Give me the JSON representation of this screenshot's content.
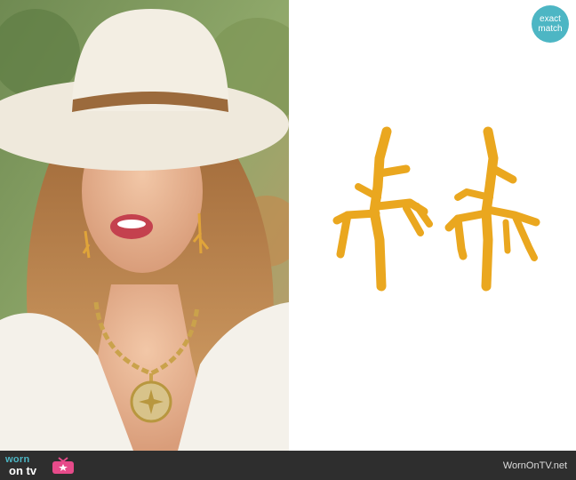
{
  "badge": {
    "line1": "exact",
    "line2": "match"
  },
  "footer": {
    "brand_top": "worn",
    "brand_bottom": "on tv",
    "url": "WornOnTV.net"
  },
  "colors": {
    "badge": "#4db6c4",
    "footer_bg": "#2e2e2e",
    "gold": "#e8a21e",
    "hat": "#efe9dc"
  }
}
